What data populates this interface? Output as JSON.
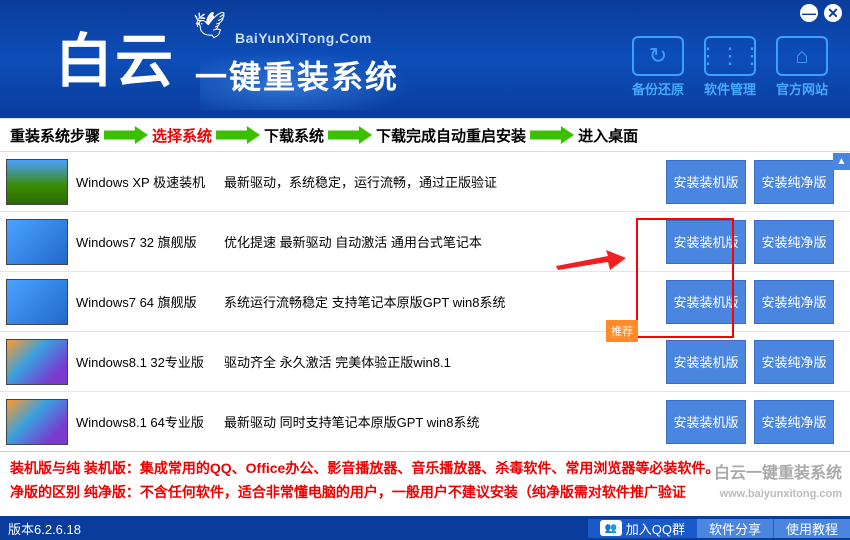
{
  "header": {
    "logo_cn": "白云",
    "logo_sub": "BaiYunXiTong.Com",
    "logo_tag": "一键重装系统",
    "win": {
      "min": "—",
      "close": "✕"
    },
    "nav": [
      {
        "icon": "↻",
        "label": "备份还原"
      },
      {
        "icon": "⋮⋮⋮",
        "label": "软件管理"
      },
      {
        "icon": "⌂",
        "label": "官方网站"
      }
    ]
  },
  "steps": [
    "重装系统步骤",
    "选择系统",
    "下载系统",
    "下载完成自动重启安装",
    "进入桌面"
  ],
  "active_step_index": 1,
  "os_list": [
    {
      "name": "Windows XP 极速装机",
      "desc": "最新驱动，系统稳定，运行流畅，通过正版验证",
      "thumb": "xp",
      "btn1": "安装装机版",
      "btn2": "安装纯净版"
    },
    {
      "name": "Windows7 32 旗舰版",
      "desc": "优化提速 最新驱动 自动激活 通用台式笔记本",
      "thumb": "w7",
      "btn1": "安装装机版",
      "btn2": "安装纯净版"
    },
    {
      "name": "Windows7 64 旗舰版",
      "desc": "系统运行流畅稳定 支持笔记本原版GPT win8系统",
      "thumb": "w7",
      "btn1": "安装装机版",
      "btn2": "安装纯净版"
    },
    {
      "name": "Windows8.1 32专业版",
      "desc": "驱动齐全 永久激活 完美体验正版win8.1",
      "thumb": "w8",
      "btn1": "安装装机版",
      "btn2": "安装纯净版"
    },
    {
      "name": "Windows8.1 64专业版",
      "desc": "最新驱动 同时支持笔记本原版GPT win8系统",
      "thumb": "w8",
      "btn1": "安装装机版",
      "btn2": "安装纯净版"
    }
  ],
  "rec_tag": "推荐",
  "notes": {
    "label1": "装机版与纯",
    "label2": "净版的区别",
    "line1": "装机版：集成常用的QQ、Office办公、影音播放器、音乐播放器、杀毒软件、常用浏览器等必装软件。",
    "line2": "纯净版：不含任何软件，适合非常懂电脑的用户，一般用户不建议安装（纯净版需对软件推广验证"
  },
  "watermark": {
    "l1": "白云一键重装系统",
    "l2": "www.baiyunxitong.com"
  },
  "footer": {
    "version": "版本6.2.6.18",
    "qq": "加入QQ群",
    "share": "软件分享",
    "tutorial": "使用教程"
  }
}
